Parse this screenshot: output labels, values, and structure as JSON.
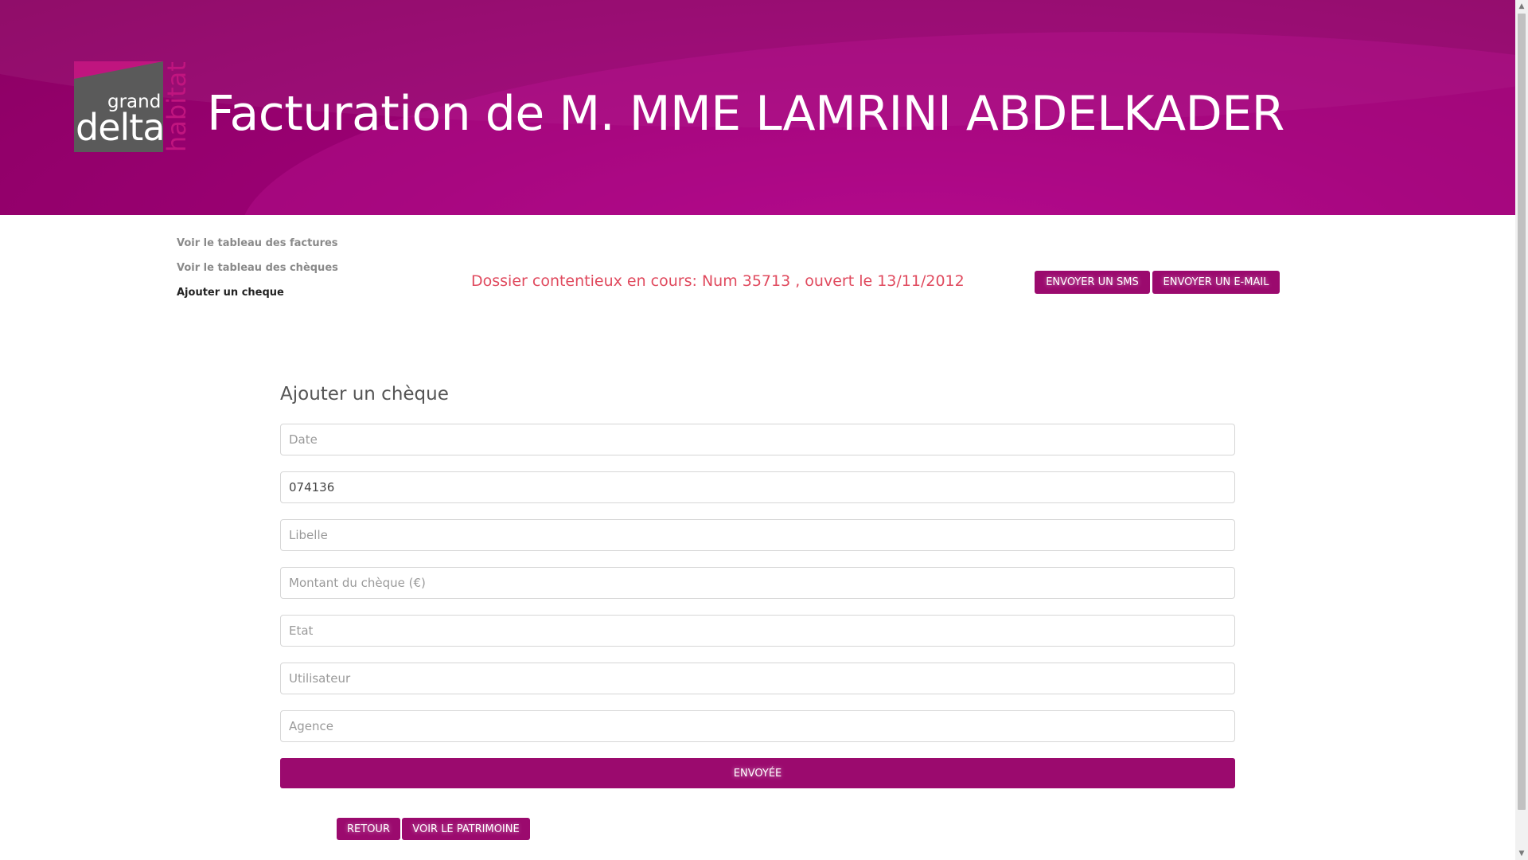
{
  "header": {
    "title": "Facturation de M. MME LAMRINI ABDELKADER",
    "logo": {
      "grand": "grand",
      "delta": "delta",
      "habitat": "habitat"
    }
  },
  "side_nav": {
    "items": [
      {
        "label": "Voir le tableau des factures",
        "active": false
      },
      {
        "label": "Voir le tableau des chèques",
        "active": false
      },
      {
        "label": "Ajouter un cheque",
        "active": true
      }
    ]
  },
  "dossier": {
    "text": "Dossier contentieux en cours: Num 35713 , ouvert le 13/11/2012"
  },
  "actions": {
    "sms_label": "ENVOYER UN SMS",
    "email_label": "ENVOYER UN E-MAIL"
  },
  "form": {
    "title": "Ajouter un chèque",
    "fields": {
      "date": {
        "placeholder": "Date",
        "value": ""
      },
      "numero": {
        "placeholder": "",
        "value": "074136"
      },
      "libelle": {
        "placeholder": "Libelle",
        "value": ""
      },
      "montant": {
        "placeholder": "Montant du chèque (€)",
        "value": ""
      },
      "etat": {
        "placeholder": "Etat",
        "value": ""
      },
      "utilisateur": {
        "placeholder": "Utilisateur",
        "value": ""
      },
      "agence": {
        "placeholder": "Agence",
        "value": ""
      }
    },
    "submit_label": "ENVOYÉE"
  },
  "footer": {
    "retour_label": "RETOUR",
    "patrimoine_label": "VOIR LE PATRIMOINE"
  },
  "colors": {
    "brand": "#9b0a6e",
    "header_bg": "#9b0074",
    "alert_text": "#e04a5e",
    "logo_grey": "#5a5a5a",
    "logo_pink": "#c0157f"
  }
}
